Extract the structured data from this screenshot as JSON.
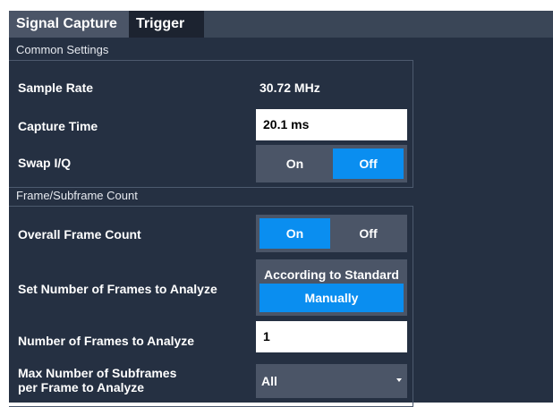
{
  "tabs": {
    "signal_capture": "Signal Capture",
    "trigger": "Trigger"
  },
  "common_settings": {
    "title": "Common Settings",
    "sample_rate": {
      "label": "Sample Rate",
      "value": "30.72 MHz"
    },
    "capture_time": {
      "label": "Capture Time",
      "value": "20.1 ms"
    },
    "swap_iq": {
      "label": "Swap I/Q",
      "on": "On",
      "off": "Off",
      "selected": "Off"
    }
  },
  "frame_count": {
    "title": "Frame/Subframe Count",
    "overall_frame_count": {
      "label": "Overall Frame Count",
      "on": "On",
      "off": "Off",
      "selected": "On"
    },
    "set_number_frames": {
      "label": "Set Number of Frames to Analyze",
      "option_standard": "According to Standard",
      "option_manual": "Manually",
      "selected": "Manually"
    },
    "number_frames": {
      "label": "Number of Frames to Analyze",
      "value": "1"
    },
    "max_subframes": {
      "label_line1": "Max Number of Subframes",
      "label_line2": "per Frame to Analyze",
      "value": "All"
    }
  },
  "colors": {
    "background": "#253042",
    "accent": "#0a8ef0",
    "control": "#4b5567"
  }
}
